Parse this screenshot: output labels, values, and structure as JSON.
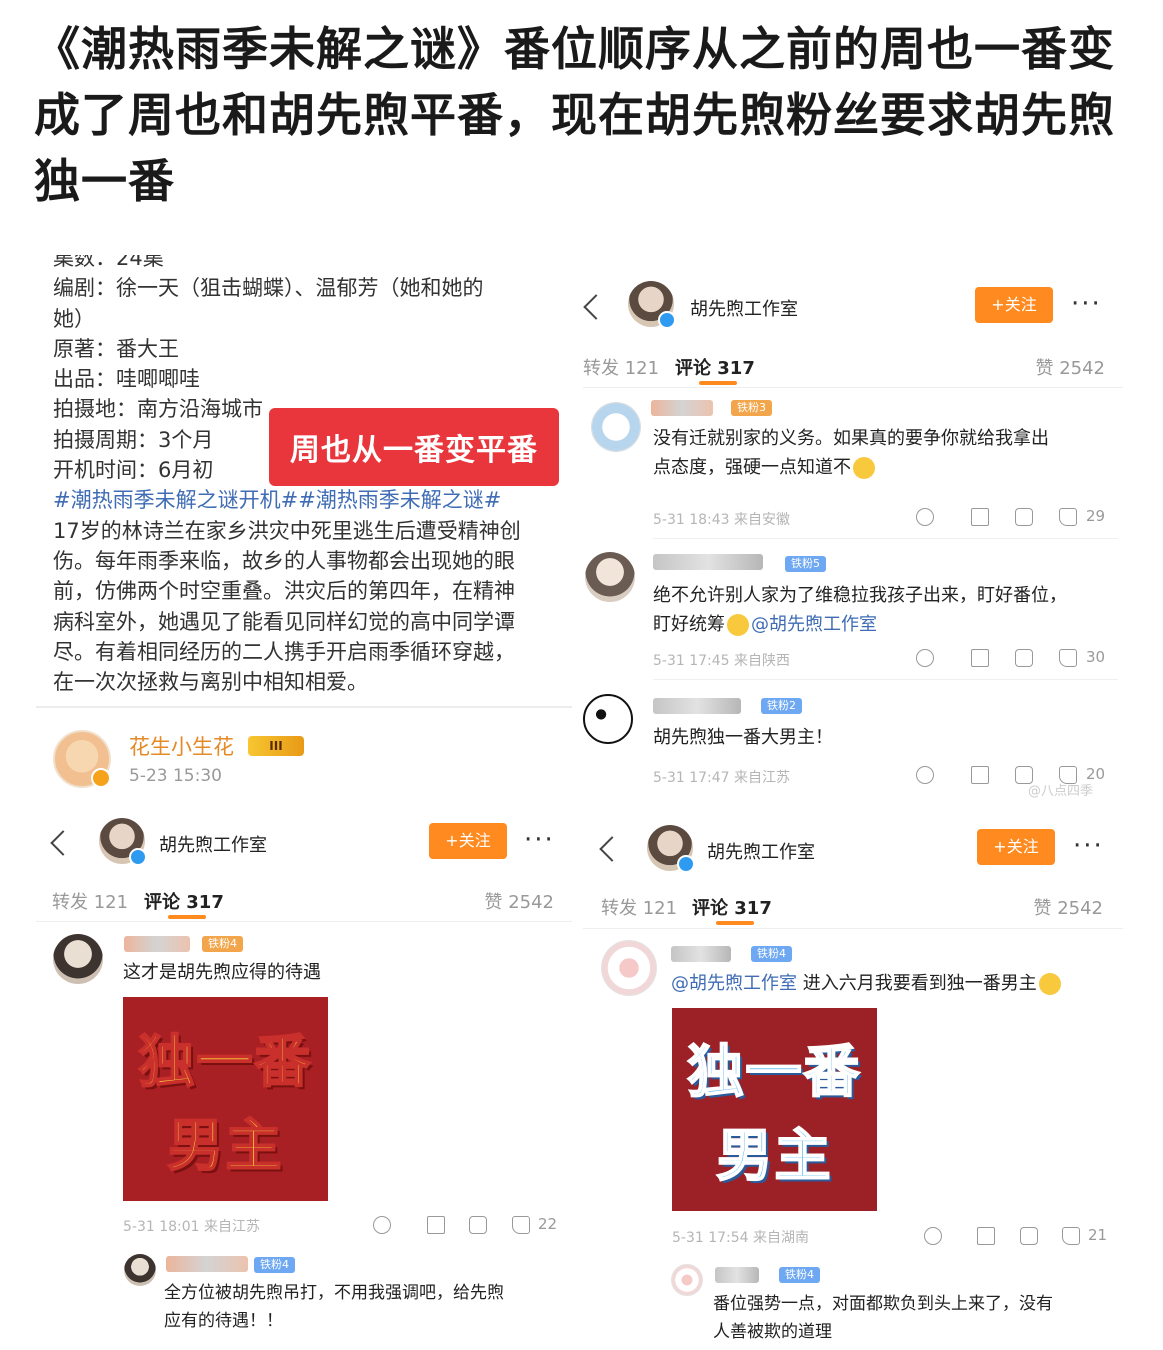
{
  "headline": "《潮热雨季未解之谜》番位顺序从之前的周也一番变成了周也和胡先煦平番，现在胡先煦粉丝要求胡先煦独一番",
  "info": {
    "lines": [
      "集数：24集",
      "编剧：徐一天（狙击蝴蝶）、温郁芳（她和她的",
      "她）",
      "原著：番大王",
      "出品：哇唧唧哇",
      "拍摄地：南方沿海城市",
      "拍摄周期：3个月",
      "开机时间：6月初",
      "#潮热雨季未解之谜开机##潮热雨季未解之谜#",
      "17岁的林诗兰在家乡洪灾中死里逃生后遭受精神创",
      "伤。每年雨季来临，故乡的人事物都会出现她的眼",
      "前，仿佛两个时空重叠。洪灾后的第四年，在精神",
      "病科室外，她遇见了能看见同样幻觉的高中同学谭",
      "尽。有着相同经历的二人携手开启雨季循环穿越，",
      "在一次次拯救与离别中相知相爱。"
    ],
    "overlay": "周也从一番变平番",
    "poster_name": "花生小生花",
    "poster_badge": "III",
    "poster_time": "5-23 15:30"
  },
  "shared": {
    "account": "胡先煦工作室",
    "follow": "+关注",
    "more": "···",
    "reposts": "转发 121",
    "comments": "评论 317",
    "likes": "赞 2542"
  },
  "panel_tr": {
    "c1_badge": "铁粉3",
    "c1_text1": "没有迁就别家的义务。如果真的要争你就给我拿出",
    "c1_text2": "点态度，强硬一点知道不",
    "c1_meta": "5-31 18:43  来自安徽",
    "c1_likes": "29",
    "c2_badge": "铁粉5",
    "c2_text1": "绝不允许别人家为了维稳拉我孩子出来，盯好番位，",
    "c2_text2_a": "盯好统筹",
    "c2_mention": "@胡先煦工作室",
    "c2_meta": "5-31 17:45  来自陕西",
    "c2_likes": "30",
    "c3_badge": "铁粉2",
    "c3_text": "胡先煦独一番大男主！",
    "c3_meta": "5-31 17:47  来自江苏",
    "c3_likes": "20"
  },
  "panel_bl": {
    "c1_badge": "铁粉4",
    "c1_text": "这才是胡先煦应得的待遇",
    "sticker_line1": "独一番",
    "sticker_line2": "男主",
    "c1_meta": "5-31 18:01  来自江苏",
    "c1_likes": "22",
    "r1_badge": "铁粉4",
    "r1_text1": "全方位被胡先煦吊打，不用我强调吧，给先煦",
    "r1_text2": "应有的待遇！！"
  },
  "panel_br": {
    "c1_badge": "铁粉4",
    "c1_mention": "@胡先煦工作室",
    "c1_text": " 进入六月我要看到独一番男主",
    "sticker_line1": "独一番",
    "sticker_line2": "男主",
    "c1_meta": "5-31 17:54  来自湖南",
    "c1_likes": "21",
    "r1_badge": "铁粉4",
    "r1_text1": "番位强势一点，对面都欺负到头上来了，没有",
    "r1_text2": "人善被欺的道理"
  },
  "watermark": "@八点四季"
}
